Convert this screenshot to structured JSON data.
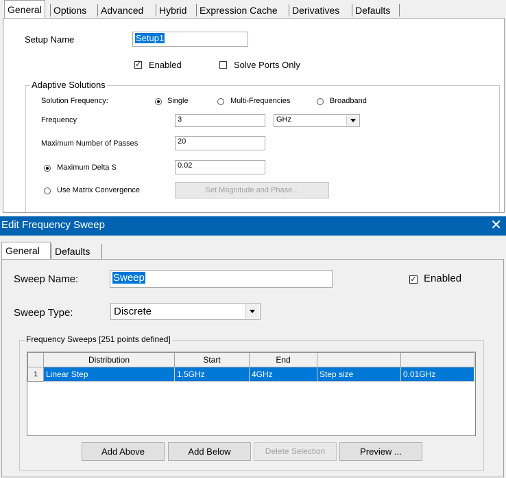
{
  "setup_dialog": {
    "tabs": [
      "General",
      "Options",
      "Advanced",
      "Hybrid",
      "Expression Cache",
      "Derivatives",
      "Defaults"
    ],
    "setup_name_label": "Setup Name",
    "setup_name_value": "Setup1",
    "enabled_label": "Enabled",
    "enabled_checked": true,
    "solve_ports_only_label": "Solve Ports Only",
    "solve_ports_only_checked": false,
    "adaptive_group_title": "Adaptive Solutions",
    "solution_frequency_label": "Solution Frequency:",
    "solution_frequency_options": [
      "Single",
      "Multi-Frequencies",
      "Broadband"
    ],
    "solution_frequency_selected": "Single",
    "frequency_label": "Frequency",
    "frequency_value": "3",
    "frequency_unit": "GHz",
    "max_passes_label": "Maximum Number of Passes",
    "max_passes_value": "20",
    "max_delta_s_label": "Maximum Delta S",
    "max_delta_s_value": "0.02",
    "use_matrix_label": "Use Matrix Convergence",
    "set_mag_phase_button": "Set Magnitude and Phase..."
  },
  "sweep_dialog": {
    "title": "Edit Frequency Sweep",
    "close_glyph": "✕",
    "tabs": [
      "General",
      "Defaults"
    ],
    "sweep_name_label": "Sweep Name:",
    "sweep_name_value": "Sweep",
    "enabled_label": "Enabled",
    "enabled_checked": true,
    "sweep_type_label": "Sweep Type:",
    "sweep_type_value": "Discrete",
    "group_title": "Frequency Sweeps [251 points defined]",
    "table": {
      "headers": [
        "",
        "Distribution",
        "Start",
        "End",
        "",
        ""
      ],
      "rows": [
        [
          "1",
          "Linear Step",
          "1.5GHz",
          "4GHz",
          "Step size",
          "0.01GHz"
        ]
      ]
    },
    "buttons": {
      "add_above": "Add Above",
      "add_below": "Add Below",
      "delete_selection": "Delete Selection",
      "preview": "Preview ..."
    }
  },
  "colors": {
    "titlebar": "#0063b1",
    "selection": "#0078d7",
    "dialog_bg": "#f0f0f0"
  }
}
